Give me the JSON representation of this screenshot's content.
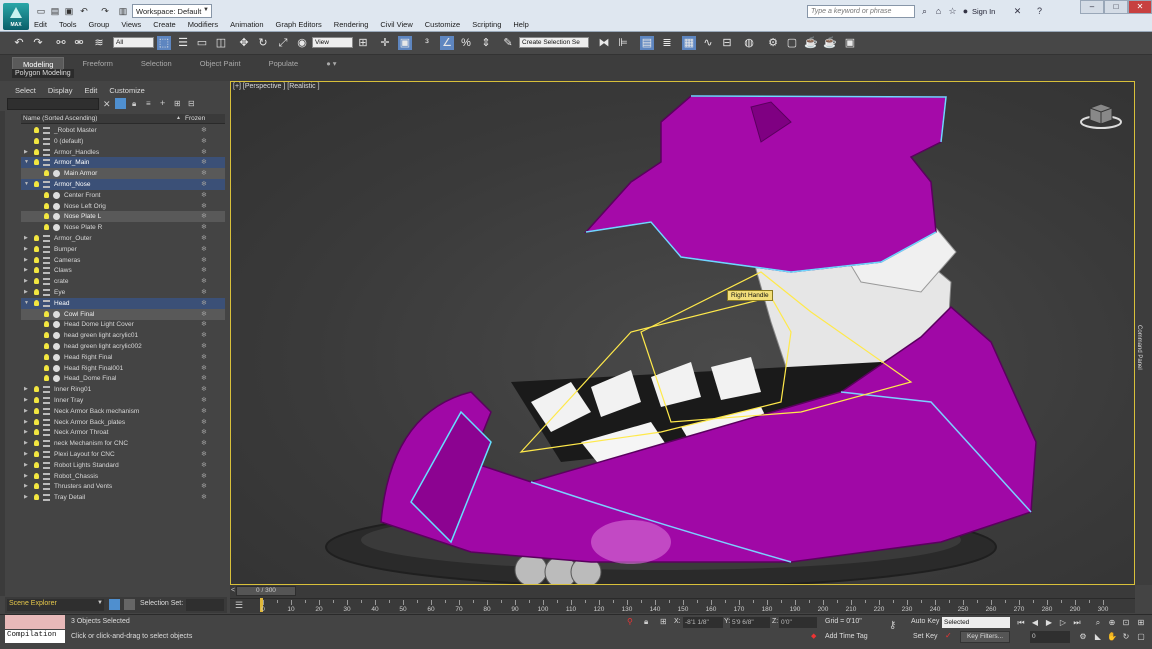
{
  "titlebar": {
    "workspace": "Workspace: Default",
    "search_placeholder": "Type a keyword or phrase",
    "signin": "Sign In",
    "app_logo_text": "MAX"
  },
  "menu": [
    "Edit",
    "Tools",
    "Group",
    "Views",
    "Create",
    "Modifiers",
    "Animation",
    "Graph Editors",
    "Rendering",
    "Civil View",
    "Customize",
    "Scripting",
    "Help"
  ],
  "toolbar": {
    "selection_filter": "All",
    "ref_coord": "View",
    "named_selection": "Create Selection Se"
  },
  "ribbon": {
    "tabs": [
      "Modeling",
      "Freeform",
      "Selection",
      "Object Paint",
      "Populate"
    ],
    "active_tab": "Modeling",
    "panel_label": "Polygon Modeling"
  },
  "scene_explorer": {
    "menu": [
      "Select",
      "Display",
      "Edit",
      "Customize"
    ],
    "col_name": "Name (Sorted Ascending)",
    "col_frozen": "Frozen",
    "rows": [
      {
        "label": "_Robot Master",
        "kind": "layer",
        "depth": 0,
        "exp": "",
        "state": ""
      },
      {
        "label": "0 (default)",
        "kind": "layer",
        "depth": 0,
        "exp": "",
        "state": ""
      },
      {
        "label": "Armor_Handles",
        "kind": "layer",
        "depth": 0,
        "exp": "▶",
        "state": ""
      },
      {
        "label": "Armor_Main",
        "kind": "layer",
        "depth": 0,
        "exp": "▼",
        "state": "sel"
      },
      {
        "label": "Main Armor",
        "kind": "obj",
        "depth": 1,
        "exp": "",
        "state": "child"
      },
      {
        "label": "Armor_Nose",
        "kind": "layer",
        "depth": 0,
        "exp": "▼",
        "state": "sel"
      },
      {
        "label": "Center Front",
        "kind": "obj",
        "depth": 1,
        "exp": "",
        "state": ""
      },
      {
        "label": "Nose Left Orig",
        "kind": "obj",
        "depth": 1,
        "exp": "",
        "state": ""
      },
      {
        "label": "Nose Plate L",
        "kind": "obj",
        "depth": 1,
        "exp": "",
        "state": "child"
      },
      {
        "label": "Nose Plate R",
        "kind": "obj",
        "depth": 1,
        "exp": "",
        "state": ""
      },
      {
        "label": "Armor_Outer",
        "kind": "layer",
        "depth": 0,
        "exp": "▶",
        "state": ""
      },
      {
        "label": "Bumper",
        "kind": "layer",
        "depth": 0,
        "exp": "▶",
        "state": ""
      },
      {
        "label": "Cameras",
        "kind": "layer",
        "depth": 0,
        "exp": "▶",
        "state": ""
      },
      {
        "label": "Claws",
        "kind": "layer",
        "depth": 0,
        "exp": "▶",
        "state": ""
      },
      {
        "label": "crate",
        "kind": "layer",
        "depth": 0,
        "exp": "▶",
        "state": ""
      },
      {
        "label": "Eye",
        "kind": "layer",
        "depth": 0,
        "exp": "▶",
        "state": ""
      },
      {
        "label": "Head",
        "kind": "layer",
        "depth": 0,
        "exp": "▼",
        "state": "sel"
      },
      {
        "label": "Cowl Final",
        "kind": "obj",
        "depth": 1,
        "exp": "",
        "state": "child"
      },
      {
        "label": "Head Dome Light Cover",
        "kind": "obj",
        "depth": 1,
        "exp": "",
        "state": ""
      },
      {
        "label": "head green light acrylic01",
        "kind": "obj",
        "depth": 1,
        "exp": "",
        "state": ""
      },
      {
        "label": "head green light acrylic002",
        "kind": "obj",
        "depth": 1,
        "exp": "",
        "state": ""
      },
      {
        "label": "Head Right Final",
        "kind": "obj",
        "depth": 1,
        "exp": "",
        "state": ""
      },
      {
        "label": "Head Right Final001",
        "kind": "obj",
        "depth": 1,
        "exp": "",
        "state": ""
      },
      {
        "label": "Head_Dome Final",
        "kind": "obj",
        "depth": 1,
        "exp": "",
        "state": ""
      },
      {
        "label": "Inner Ring01",
        "kind": "layer",
        "depth": 0,
        "exp": "▶",
        "state": ""
      },
      {
        "label": "Inner Tray",
        "kind": "layer",
        "depth": 0,
        "exp": "▶",
        "state": ""
      },
      {
        "label": "Neck Armor Back mechanism",
        "kind": "layer",
        "depth": 0,
        "exp": "▶",
        "state": ""
      },
      {
        "label": "Neck Armor Back_plates",
        "kind": "layer",
        "depth": 0,
        "exp": "▶",
        "state": ""
      },
      {
        "label": "Neck Armor Throat",
        "kind": "layer",
        "depth": 0,
        "exp": "▶",
        "state": ""
      },
      {
        "label": "neck Mechanism for CNC",
        "kind": "layer",
        "depth": 0,
        "exp": "▶",
        "state": ""
      },
      {
        "label": "Plexi Layout for CNC",
        "kind": "layer",
        "depth": 0,
        "exp": "▶",
        "state": ""
      },
      {
        "label": "Robot Lights Standard",
        "kind": "layer",
        "depth": 0,
        "exp": "▶",
        "state": ""
      },
      {
        "label": "Robot_Chassis",
        "kind": "layer",
        "depth": 0,
        "exp": "▶",
        "state": ""
      },
      {
        "label": "Thrusters and Vents",
        "kind": "layer",
        "depth": 0,
        "exp": "▶",
        "state": ""
      },
      {
        "label": "Tray Detail",
        "kind": "layer",
        "depth": 0,
        "exp": "▶",
        "state": ""
      }
    ],
    "bottom_title": "Scene Explorer",
    "selection_set_label": "Selection Set:"
  },
  "viewport": {
    "label": "[+] [Perspective ] [Realistic ]",
    "tooltip": "Right Handle",
    "command_panel": "Command Panel"
  },
  "timeline": {
    "position": "0 / 300",
    "ticks": [
      0,
      10,
      20,
      30,
      40,
      50,
      60,
      70,
      80,
      90,
      100,
      110,
      120,
      130,
      140,
      150,
      160,
      170,
      180,
      190,
      200,
      210,
      220,
      230,
      240,
      250,
      260,
      270,
      280,
      290,
      300
    ]
  },
  "status": {
    "script_mode": "Compilation",
    "selection": "3 Objects Selected",
    "prompt": "Click or click-and-drag to select objects",
    "x_label": "X:",
    "x_value": "-8'1 1/8\"",
    "y_label": "Y:",
    "y_value": "5'9 6/8\"",
    "z_label": "Z:",
    "z_value": "0'0\"",
    "grid": "Grid = 0'10\"",
    "add_time_tag": "Add Time Tag",
    "auto_key": "Auto Key",
    "set_key": "Set Key",
    "key_mode": "Selected",
    "key_filters": "Key Filters...",
    "frame": "0"
  }
}
